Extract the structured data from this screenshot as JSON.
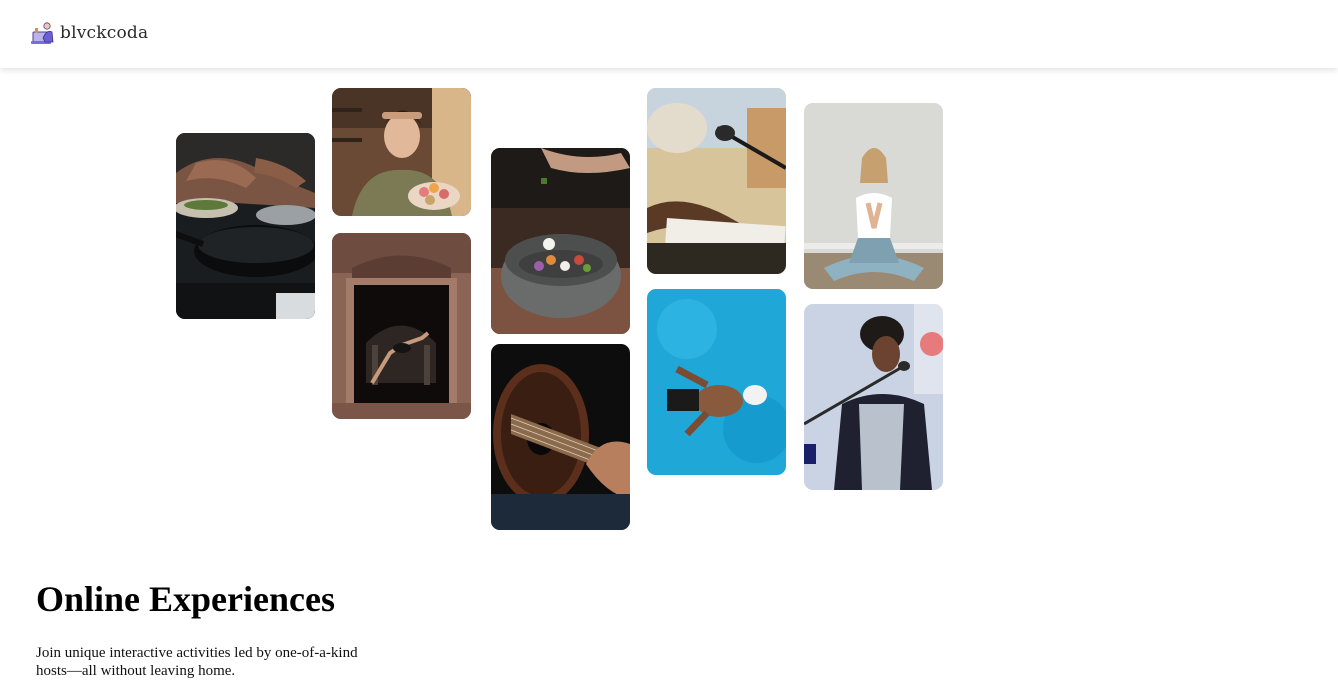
{
  "navbar": {
    "brand_name": "blvckcoda",
    "logo_icon": "laptop-person-icon"
  },
  "gallery": {
    "photos": [
      {
        "name": "cooking-pan-photo",
        "subject": "hands cooking with a pan"
      },
      {
        "name": "woman-macarons-photo",
        "subject": "woman holding macarons"
      },
      {
        "name": "dancer-doorway-photo",
        "subject": "dancer leaping in doorway"
      },
      {
        "name": "bowl-seasoning-photo",
        "subject": "seasoning a stone bowl"
      },
      {
        "name": "guitar-photo",
        "subject": "playing acoustic guitar"
      },
      {
        "name": "piano-microphone-photo",
        "subject": "keyboard with microphone"
      },
      {
        "name": "swimmer-photo",
        "subject": "swimmer in pool"
      },
      {
        "name": "yoga-photo",
        "subject": "woman meditating"
      },
      {
        "name": "singer-photo",
        "subject": "singer at microphone"
      }
    ]
  },
  "hero": {
    "title": "Online Experiences",
    "description": "Join unique interactive activities led by one-of-a-kind hosts—all without leaving home."
  }
}
